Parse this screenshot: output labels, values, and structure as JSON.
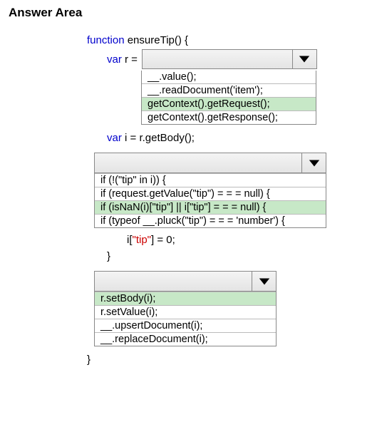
{
  "title": "Answer Area",
  "code": {
    "fn_kw": "function",
    "fn_name": "ensureTip() {",
    "var_kw": "var",
    "r_decl": "r =",
    "i_decl": "i = r.getBody();",
    "assign_line_a": "i[",
    "assign_key": "\"tip\"",
    "assign_line_b": "] = 0;",
    "close_inner": "}",
    "close_outer": "}"
  },
  "dropdown1": {
    "options": [
      "__.value();",
      "__.readDocument('item');",
      "getContext().getRequest();",
      "getContext().getResponse();"
    ],
    "selected_index": 2
  },
  "dropdown2": {
    "options": [
      "if (!(\"tip\" in i)) {",
      "if (request.getValue(\"tip\") = = = null) {",
      "if (isNaN(i)[\"tip\"] || i[\"tip\"] = = = null) {",
      "if (typeof __.pluck(\"tip\") = = = 'number') {"
    ],
    "selected_index": 2
  },
  "dropdown3": {
    "options": [
      "r.setBody(i);",
      "r.setValue(i);",
      "__.upsertDocument(i);",
      "__.replaceDocument(i);"
    ],
    "selected_index": 0
  }
}
